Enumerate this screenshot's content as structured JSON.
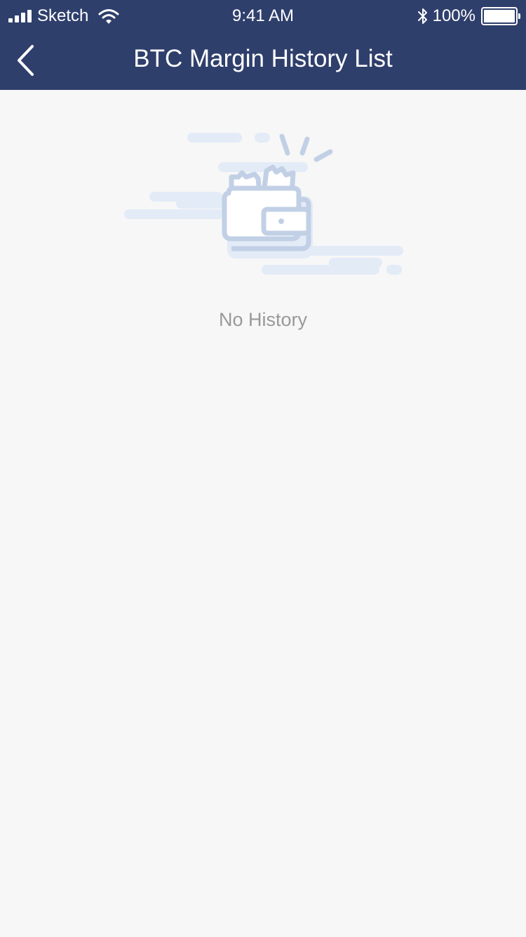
{
  "status_bar": {
    "carrier": "Sketch",
    "time": "9:41 AM",
    "battery_percent": "100%",
    "icons": [
      "signal-icon",
      "wifi-icon",
      "bluetooth-icon",
      "battery-icon"
    ]
  },
  "nav": {
    "title": "BTC Margin History List",
    "back_icon": "chevron-left-icon"
  },
  "empty_state": {
    "message": "No History",
    "illustration": "empty-wallet-illustration"
  },
  "colors": {
    "header": "#2f3f6c",
    "background": "#f7f7f7",
    "illustration_stroke": "#c2d0e6",
    "illustration_accent": "#e3ebf7",
    "empty_text": "#999999"
  }
}
